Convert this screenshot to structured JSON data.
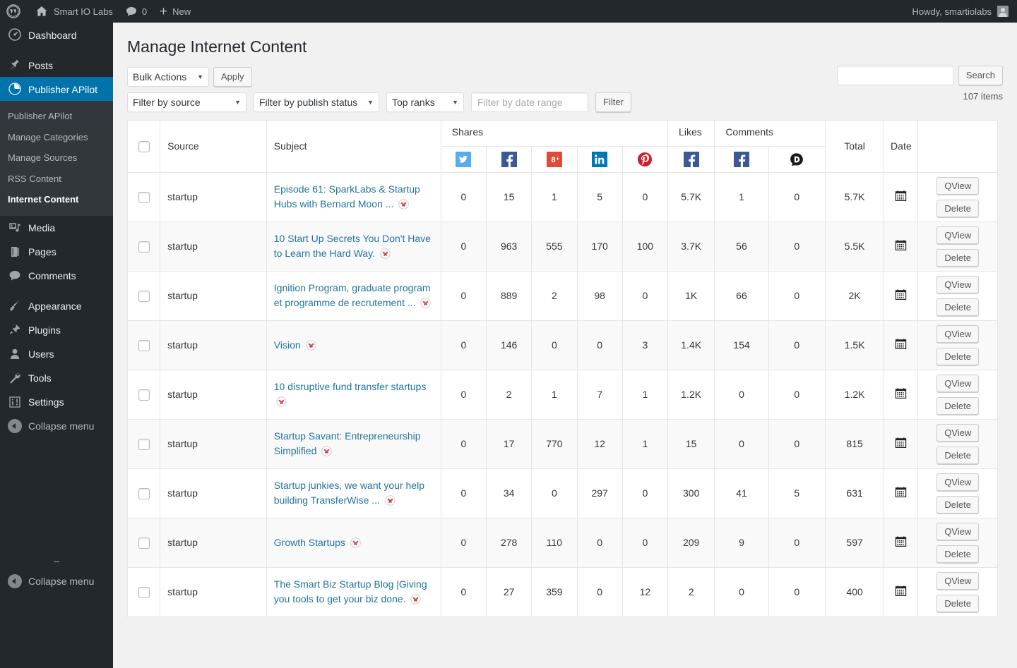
{
  "adminbar": {
    "logo_icon": "wordpress-logo-icon",
    "site_name": "Smart IO Labs",
    "home_icon": "home-icon",
    "comments_icon": "comment-bubble-icon",
    "comments_count": "0",
    "new_icon": "plus-icon",
    "new_label": "New",
    "howdy": "Howdy, smartiolabs",
    "avatar_icon": "avatar-icon"
  },
  "sidebar": {
    "items": [
      {
        "label": "Dashboard",
        "icon": "dashboard-icon",
        "active": false
      },
      {
        "label": "Publisher APilot",
        "icon": "pie-chart-icon",
        "active": true
      },
      {
        "label": "Media",
        "icon": "media-icon",
        "active": false
      },
      {
        "label": "Pages",
        "icon": "pages-icon",
        "active": false
      },
      {
        "label": "Comments",
        "icon": "comments-icon",
        "active": false
      },
      {
        "label": "Appearance",
        "icon": "appearance-brush-icon",
        "active": false
      },
      {
        "label": "Plugins",
        "icon": "plugins-plug-icon",
        "active": false
      },
      {
        "label": "Users",
        "icon": "users-icon",
        "active": false
      },
      {
        "label": "Tools",
        "icon": "tools-wrench-icon",
        "active": false
      },
      {
        "label": "Settings",
        "icon": "settings-sliders-icon",
        "active": false
      }
    ],
    "posts_label": "Posts",
    "posts_icon": "pin-icon",
    "submenu": [
      {
        "label": "Publisher APilot",
        "current": false
      },
      {
        "label": "Manage Categories",
        "current": false
      },
      {
        "label": "Manage Sources",
        "current": false
      },
      {
        "label": "RSS Content",
        "current": false
      },
      {
        "label": "Internet Content",
        "current": true
      }
    ],
    "collapse_label": "Collapse menu",
    "collapse_icon": "collapse-arrow-icon",
    "dash": "–"
  },
  "page": {
    "title": "Manage Internet Content"
  },
  "toolbar": {
    "bulk_actions_label": "Bulk Actions",
    "apply_label": "Apply",
    "filter_source_label": "Filter by source",
    "filter_publish_status_label": "Filter by publish status",
    "top_ranks_label": "Top ranks",
    "date_range_placeholder": "Filter by date range",
    "date_range_value": "",
    "filter_label": "Filter",
    "search_value": "",
    "search_button_label": "Search",
    "items_count": "107 items",
    "caret_icon": "chevron-down-icon"
  },
  "table": {
    "headers": {
      "select_all": "select-all-checkbox",
      "source": "Source",
      "subject": "Subject",
      "shares": "Shares",
      "likes": "Likes",
      "comments": "Comments",
      "total": "Total",
      "date": "Date",
      "actions": ""
    },
    "metric_icons": [
      {
        "name": "twitter-icon",
        "group": "shares",
        "color": "#55acee"
      },
      {
        "name": "facebook-icon",
        "group": "shares",
        "color": "#3b5998"
      },
      {
        "name": "googleplus-icon",
        "group": "shares",
        "color": "#dd4b39"
      },
      {
        "name": "linkedin-icon",
        "group": "shares",
        "color": "#0077b5"
      },
      {
        "name": "pinterest-icon",
        "group": "shares",
        "color": "#cb2027"
      },
      {
        "name": "facebook-icon",
        "group": "likes",
        "color": "#3b5998"
      },
      {
        "name": "facebook-icon",
        "group": "comments",
        "color": "#3b5998"
      },
      {
        "name": "disqus-icon",
        "group": "comments",
        "color": "#1a1a1a"
      }
    ],
    "row_actions": {
      "qview": "QView",
      "delete": "Delete"
    },
    "date_icon": "calendar-icon",
    "remove_icon": "remove-x-icon",
    "rows": [
      {
        "source": "startup",
        "subject": "Episode 61: SparkLabs & Startup Hubs with Bernard Moon ...",
        "metrics": [
          "0",
          "15",
          "1",
          "5",
          "0",
          "5.7K",
          "1",
          "0"
        ],
        "total": "5.7K"
      },
      {
        "source": "startup",
        "subject": "10 Start Up Secrets You Don't Have to Learn the Hard Way.",
        "metrics": [
          "0",
          "963",
          "555",
          "170",
          "100",
          "3.7K",
          "56",
          "0"
        ],
        "total": "5.5K"
      },
      {
        "source": "startup",
        "subject": "Ignition Program, graduate program et programme de recrutement ...",
        "metrics": [
          "0",
          "889",
          "2",
          "98",
          "0",
          "1K",
          "66",
          "0"
        ],
        "total": "2K"
      },
      {
        "source": "startup",
        "subject": "Vision",
        "metrics": [
          "0",
          "146",
          "0",
          "0",
          "3",
          "1.4K",
          "154",
          "0"
        ],
        "total": "1.5K"
      },
      {
        "source": "startup",
        "subject": "10 disruptive fund transfer startups",
        "metrics": [
          "0",
          "2",
          "1",
          "7",
          "1",
          "1.2K",
          "0",
          "0"
        ],
        "total": "1.2K"
      },
      {
        "source": "startup",
        "subject": "Startup Savant: Entrepreneurship Simplified",
        "metrics": [
          "0",
          "17",
          "770",
          "12",
          "1",
          "15",
          "0",
          "0"
        ],
        "total": "815"
      },
      {
        "source": "startup",
        "subject": "Startup junkies, we want your help building TransferWise ...",
        "metrics": [
          "0",
          "34",
          "0",
          "297",
          "0",
          "300",
          "41",
          "5"
        ],
        "total": "631"
      },
      {
        "source": "startup",
        "subject": "Growth Startups",
        "metrics": [
          "0",
          "278",
          "110",
          "0",
          "0",
          "209",
          "9",
          "0"
        ],
        "total": "597"
      },
      {
        "source": "startup",
        "subject": "The Smart Biz Startup Blog |Giving you tools to get your biz done.",
        "metrics": [
          "0",
          "27",
          "359",
          "0",
          "12",
          "2",
          "0",
          "0"
        ],
        "total": "400"
      }
    ]
  }
}
